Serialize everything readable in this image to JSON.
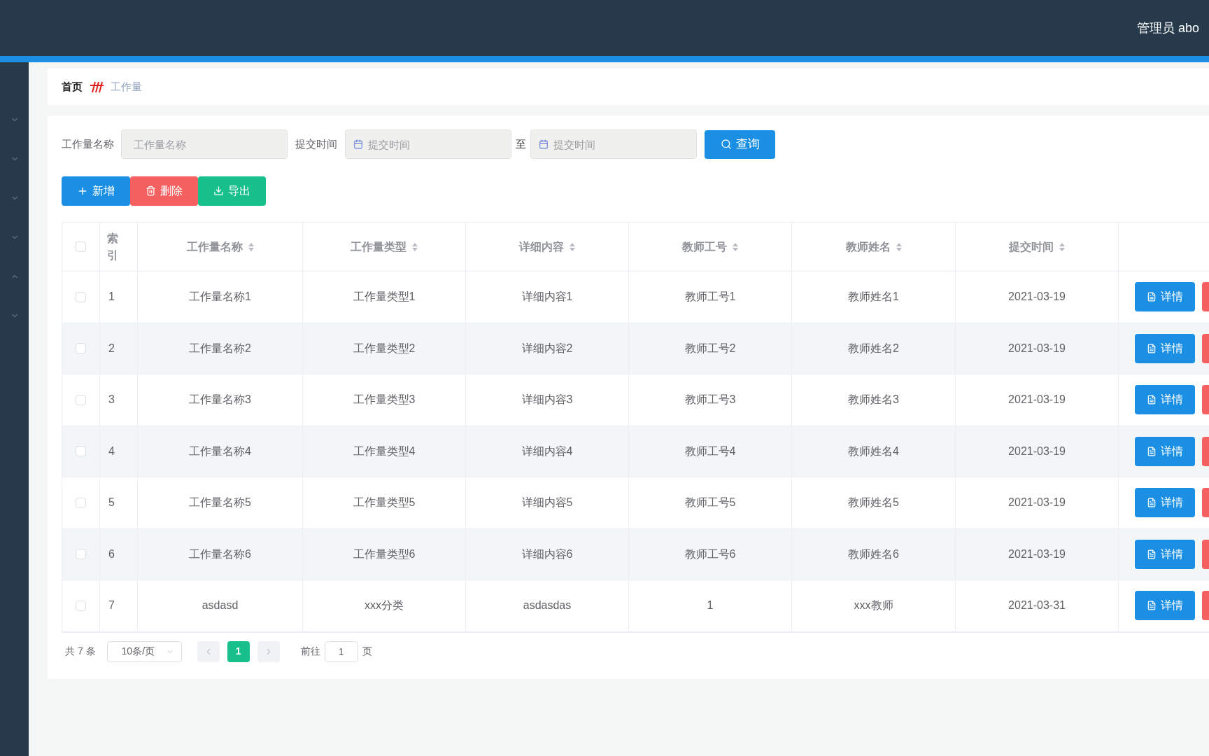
{
  "header": {
    "user": "管理员 abo"
  },
  "sidebar": {
    "items": [
      {
        "expanded": false
      },
      {
        "expanded": false
      },
      {
        "expanded": false
      },
      {
        "expanded": false
      },
      {
        "expanded": true
      },
      {
        "expanded": false
      }
    ]
  },
  "breadcrumb": [
    "首页",
    "工作量"
  ],
  "filters": {
    "name_label": "工作量名称",
    "name_placeholder": "工作量名称",
    "time_label": "提交时间",
    "start_placeholder": "提交时间",
    "range_separator": "至",
    "end_placeholder": "提交时间",
    "search_button": "查询"
  },
  "toolbar": [
    {
      "kind": "add",
      "label": "新增"
    },
    {
      "kind": "delete",
      "label": "删除"
    },
    {
      "kind": "export",
      "label": "导出"
    }
  ],
  "table": {
    "select_all_checked": false,
    "columns": [
      {
        "label": "索引",
        "sortable": false
      },
      {
        "label": "工作量名称",
        "sortable": true
      },
      {
        "label": "工作量类型",
        "sortable": true
      },
      {
        "label": "详细内容",
        "sortable": true
      },
      {
        "label": "教师工号",
        "sortable": true
      },
      {
        "label": "教师姓名",
        "sortable": true
      },
      {
        "label": "提交时间",
        "sortable": true
      }
    ],
    "rows": [
      {
        "checked": false,
        "cells": [
          "1",
          "工作量名称1",
          "工作量类型1",
          "详细内容1",
          "教师工号1",
          "教师姓名1",
          "2021-03-19"
        ],
        "action": "详情"
      },
      {
        "checked": false,
        "cells": [
          "2",
          "工作量名称2",
          "工作量类型2",
          "详细内容2",
          "教师工号2",
          "教师姓名2",
          "2021-03-19"
        ],
        "action": "详情"
      },
      {
        "checked": false,
        "cells": [
          "3",
          "工作量名称3",
          "工作量类型3",
          "详细内容3",
          "教师工号3",
          "教师姓名3",
          "2021-03-19"
        ],
        "action": "详情"
      },
      {
        "checked": false,
        "cells": [
          "4",
          "工作量名称4",
          "工作量类型4",
          "详细内容4",
          "教师工号4",
          "教师姓名4",
          "2021-03-19"
        ],
        "action": "详情"
      },
      {
        "checked": false,
        "cells": [
          "5",
          "工作量名称5",
          "工作量类型5",
          "详细内容5",
          "教师工号5",
          "教师姓名5",
          "2021-03-19"
        ],
        "action": "详情"
      },
      {
        "checked": false,
        "cells": [
          "6",
          "工作量名称6",
          "工作量类型6",
          "详细内容6",
          "教师工号6",
          "教师姓名6",
          "2021-03-19"
        ],
        "action": "详情"
      },
      {
        "checked": false,
        "cells": [
          "7",
          "asdasd",
          "xxx分类",
          "asdasdas",
          "1",
          "xxx教师",
          "2021-03-31"
        ],
        "action": "详情"
      }
    ]
  },
  "pagination": {
    "total": "共 7 条",
    "page_size": "10条/页",
    "pages": [
      {
        "label": "1",
        "selected": true
      }
    ],
    "goto_label": "前往",
    "goto_value": "1",
    "goto_suffix": "页"
  }
}
